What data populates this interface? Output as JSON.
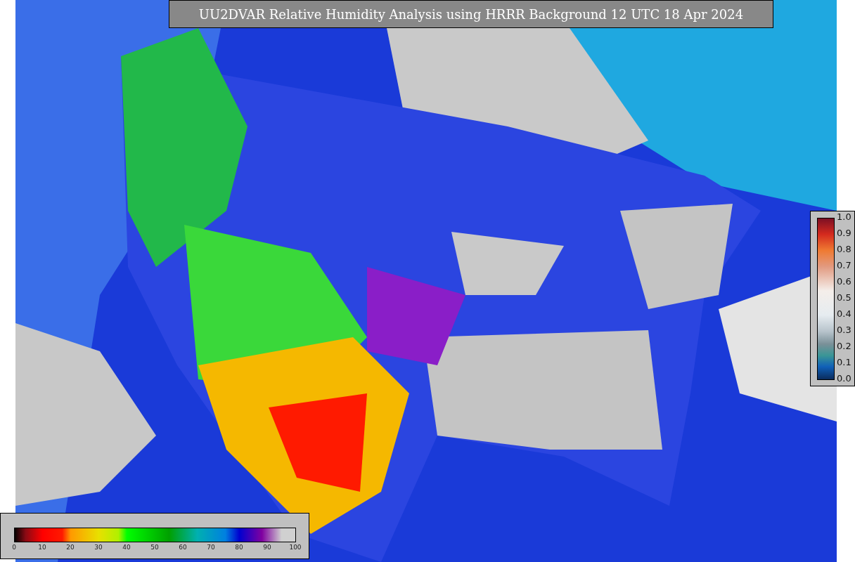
{
  "title": "UU2DVAR Relative Humidity Analysis using HRRR Background 12 UTC 18 Apr 2024",
  "humidity_colorbar": {
    "ticks": [
      "0",
      "10",
      "20",
      "30",
      "40",
      "50",
      "60",
      "70",
      "80",
      "90",
      "100"
    ]
  },
  "ratio_colorbar": {
    "ticks": [
      "1.0",
      "0.9",
      "0.8",
      "0.7",
      "0.6",
      "0.5",
      "0.4",
      "0.3",
      "0.2",
      "0.1",
      "0.0"
    ]
  }
}
